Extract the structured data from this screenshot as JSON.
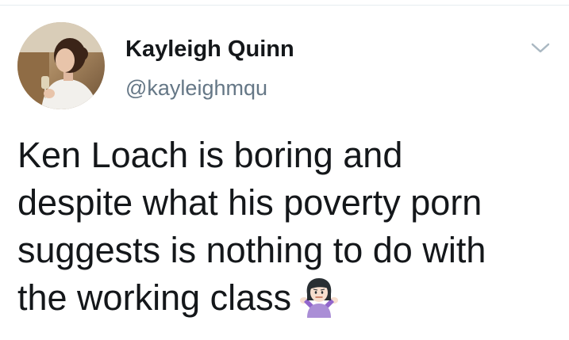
{
  "tweet": {
    "author": {
      "display_name": "Kayleigh Quinn",
      "handle": "@kayleighmqu"
    },
    "text_lines": [
      "Ken Loach is boring and",
      "despite what his poverty porn",
      "suggests is nothing to do with",
      "the working class"
    ],
    "emoji": "person-shrugging-emoji",
    "menu_icon": "chevron-down-icon"
  },
  "colors": {
    "text_primary": "#14171a",
    "text_secondary": "#657786",
    "divider": "#e6ecf0",
    "caret": "#aab8c2"
  }
}
